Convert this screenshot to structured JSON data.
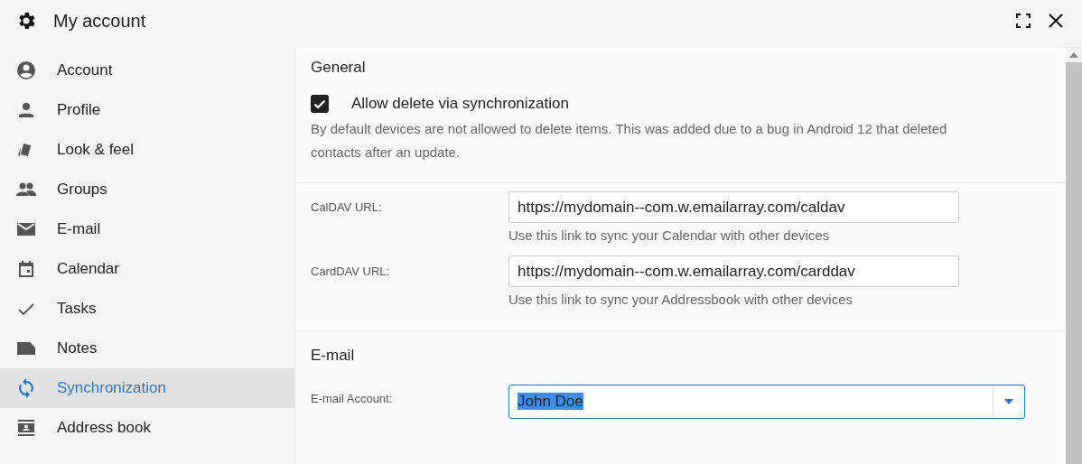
{
  "window": {
    "title": "My account"
  },
  "sidebar": {
    "items": [
      {
        "label": "Account",
        "selected": false
      },
      {
        "label": "Profile",
        "selected": false
      },
      {
        "label": "Look & feel",
        "selected": false
      },
      {
        "label": "Groups",
        "selected": false
      },
      {
        "label": "E-mail",
        "selected": false
      },
      {
        "label": "Calendar",
        "selected": false
      },
      {
        "label": "Tasks",
        "selected": false
      },
      {
        "label": "Notes",
        "selected": false
      },
      {
        "label": "Synchronization",
        "selected": true
      },
      {
        "label": "Address book",
        "selected": false
      }
    ]
  },
  "general": {
    "title": "General",
    "checkbox": {
      "label": "Allow delete via synchronization",
      "checked": true
    },
    "description": "By default devices are not allowed to delete items. This was added due to a bug in Android 12 that deleted contacts after an update."
  },
  "urls": [
    {
      "label": "CalDAV URL:",
      "value": "https://mydomain--com.w.emailarray.com/caldav",
      "hint": "Use this link to sync your Calendar with other devices"
    },
    {
      "label": "CardDAV URL:",
      "value": "https://mydomain--com.w.emailarray.com/carddav",
      "hint": "Use this link to sync your Addressbook with other devices"
    }
  ],
  "email": {
    "title": "E-mail",
    "account_label": "E-mail Account:",
    "account_value": "John Doe"
  }
}
